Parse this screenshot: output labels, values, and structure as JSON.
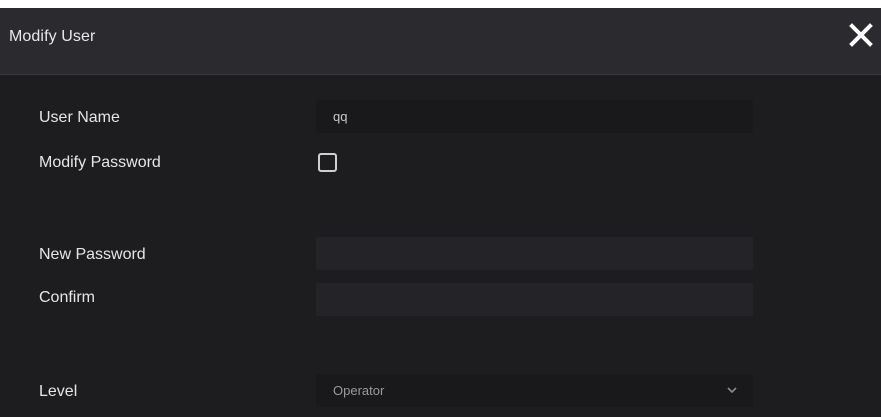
{
  "dialog": {
    "title": "Modify User",
    "close_icon": "close-icon"
  },
  "form": {
    "user_name": {
      "label": "User Name",
      "value": "qq"
    },
    "modify_password": {
      "label": "Modify Password",
      "checked": false
    },
    "new_password": {
      "label": "New Password",
      "value": ""
    },
    "confirm": {
      "label": "Confirm",
      "value": ""
    },
    "level": {
      "label": "Level",
      "selected": "Operator",
      "chevron_icon": "chevron-down-icon"
    }
  },
  "colors": {
    "background": "#1d1d20",
    "titlebar": "#2b2b2f",
    "text": "#e6e6e6"
  }
}
